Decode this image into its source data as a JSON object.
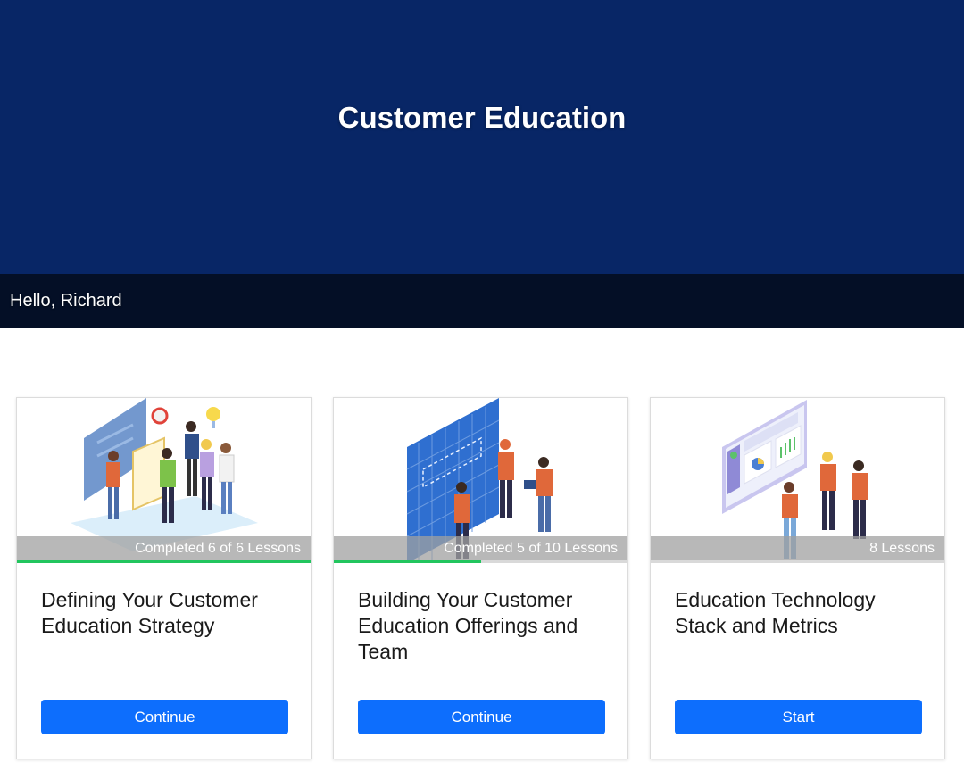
{
  "header": {
    "title": "Customer Education"
  },
  "greeting": {
    "text": "Hello, Richard"
  },
  "colors": {
    "hero_bg": "#082666",
    "greeting_bg": "#040f26",
    "button": "#0d6efd",
    "progress": "#22c55e"
  },
  "courses": [
    {
      "title": "Defining Your Customer Education Strategy",
      "status": "Completed 6 of 6 Lessons",
      "progress": 1.0,
      "button_label": "Continue",
      "illustration": "team-strategy-board-illustration"
    },
    {
      "title": "Building Your Customer Education Offerings and Team",
      "status": "Completed 5 of 10 Lessons",
      "progress": 0.5,
      "button_label": "Continue",
      "illustration": "blueprint-planning-illustration"
    },
    {
      "title": "Education Technology Stack and Metrics",
      "status": "8 Lessons",
      "progress": 0,
      "button_label": "Start",
      "illustration": "dashboard-metrics-illustration"
    }
  ]
}
